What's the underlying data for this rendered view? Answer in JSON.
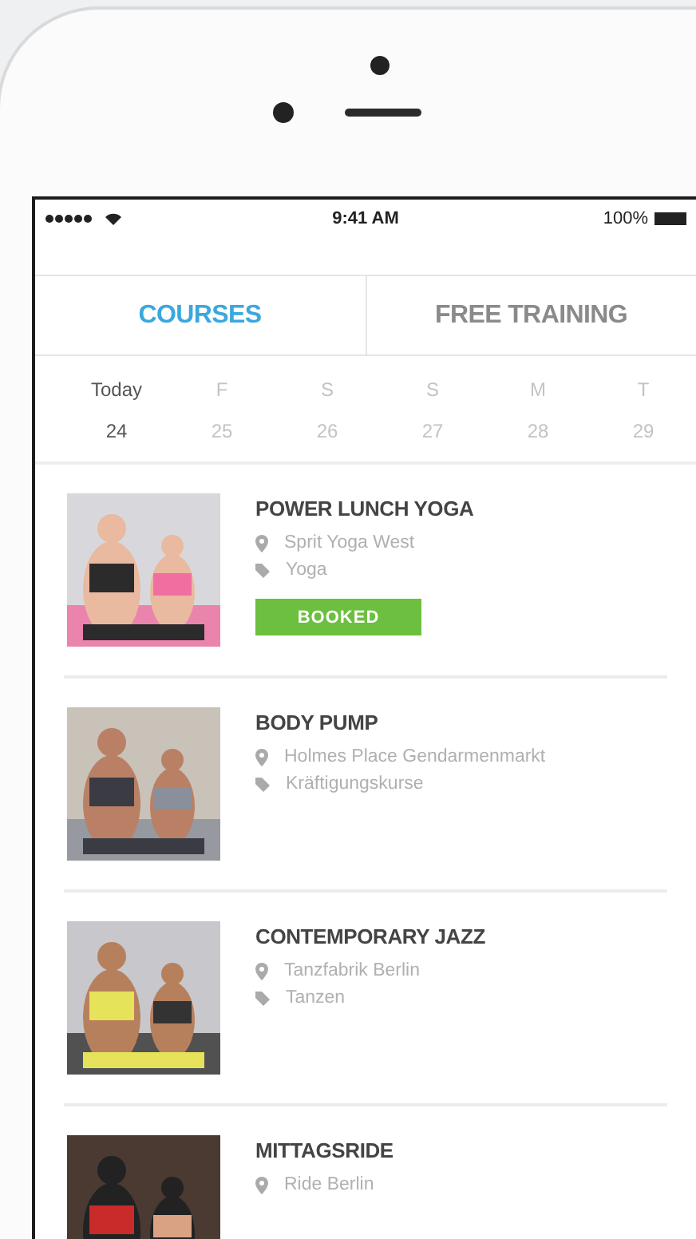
{
  "status_bar": {
    "time": "9:41 AM",
    "battery": "100%"
  },
  "tabs": [
    {
      "label": "COURSES",
      "selected": true
    },
    {
      "label": "FREE TRAINING",
      "selected": false
    }
  ],
  "days": [
    {
      "weekday": "Today",
      "date": "24",
      "selected": true
    },
    {
      "weekday": "F",
      "date": "25",
      "selected": false
    },
    {
      "weekday": "S",
      "date": "26",
      "selected": false
    },
    {
      "weekday": "S",
      "date": "27",
      "selected": false
    },
    {
      "weekday": "M",
      "date": "28",
      "selected": false
    },
    {
      "weekday": "T",
      "date": "29",
      "selected": false
    }
  ],
  "courses": [
    {
      "title": "POWER LUNCH YOGA",
      "location": "Sprit Yoga West",
      "category": "Yoga",
      "badge": "BOOKED"
    },
    {
      "title": "BODY PUMP",
      "location": "Holmes Place Gendarmenmarkt",
      "category": "Kräftigungskurse"
    },
    {
      "title": "CONTEMPORARY JAZZ",
      "location": "Tanzfabrik Berlin",
      "category": "Tanzen"
    },
    {
      "title": "MITTAGSRIDE",
      "location": "Ride Berlin"
    }
  ]
}
